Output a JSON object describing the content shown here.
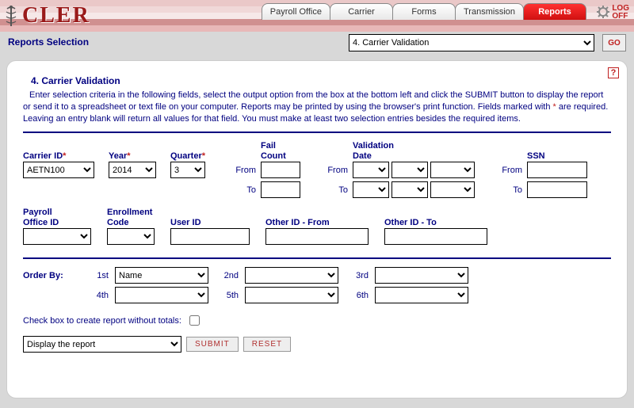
{
  "brand": "CLER",
  "tabs": [
    "Payroll Office",
    "Carrier",
    "Forms",
    "Transmission",
    "Reports"
  ],
  "active_tab_index": 4,
  "logoff": "LOG\nOFF",
  "subbar": {
    "title": "Reports Selection",
    "select_value": "4. Carrier Validation",
    "go": "GO"
  },
  "panel": {
    "title": "4. Carrier Validation",
    "desc_pre": "Enter selection criteria in the following fields, select the output option from the box at the bottom left and click the SUBMIT button to display the report or send it to a spreadsheet or text file on your computer.  Reports may be printed by using the browser's print function.  Fields marked with ",
    "desc_mid": "*",
    "desc_post": " are required.  Leaving an entry blank will return all values for that field.  You must make at least two selection entries besides the required items."
  },
  "labels": {
    "carrier_id": "Carrier ID",
    "year": "Year",
    "quarter": "Quarter",
    "fail_count": "Fail\nCount",
    "validation_date": "Validation\nDate",
    "ssn": "SSN",
    "payroll_office_id": "Payroll\nOffice ID",
    "enrollment_code": "Enrollment\nCode",
    "user_id": "User ID",
    "other_id_from": "Other ID - From",
    "other_id_to": "Other ID - To",
    "from": "From",
    "to": "To",
    "order_by": "Order By:",
    "ord1": "1st",
    "ord2": "2nd",
    "ord3": "3rd",
    "ord4": "4th",
    "ord5": "5th",
    "ord6": "6th",
    "chk": "Check box to create report without totals:",
    "submit": "SUBMIT",
    "reset": "RESET"
  },
  "values": {
    "carrier_id": "AETN100",
    "year": "2014",
    "quarter": "3",
    "order1": "Name",
    "display_option": "Display the report"
  }
}
